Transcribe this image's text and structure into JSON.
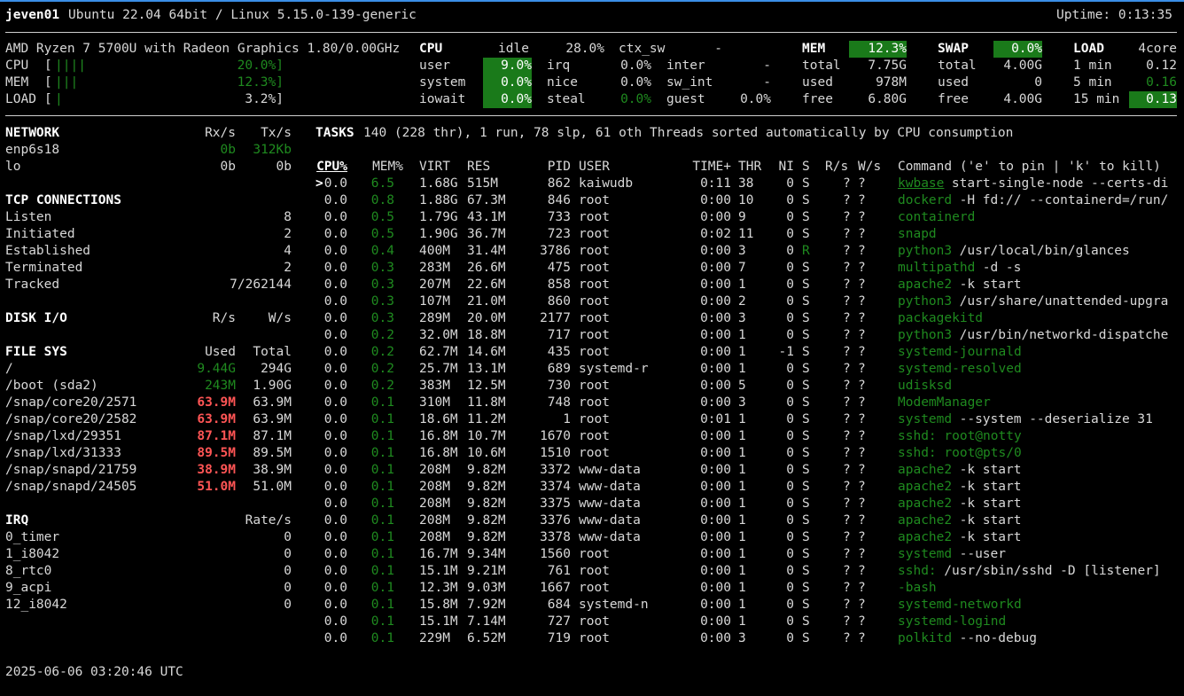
{
  "header": {
    "hostname": "jeven01",
    "os": "Ubuntu 22.04 64bit / Linux 5.15.0-139-generic",
    "uptime": "Uptime: 0:13:35"
  },
  "quicklook": {
    "cpu_name": "AMD Ryzen 7 5700U with Radeon Graphics 1.80/0.00GHz",
    "rows": [
      {
        "label": "CPU",
        "bar": "||||",
        "value": "20.0%]",
        "bar_fraction": 0.2
      },
      {
        "label": "MEM",
        "bar": "|||",
        "value": "12.3%]",
        "bar_fraction": 0.123
      },
      {
        "label": "LOAD",
        "bar": "|",
        "value": "3.2%]",
        "bar_fraction": 0.032
      }
    ]
  },
  "cpu": {
    "title": "CPU",
    "idle_label": "idle",
    "idle_value": "28.0%",
    "ctx_sw_label": "ctx_sw",
    "ctx_sw_value": "-",
    "rows": [
      {
        "l1": "user",
        "v1": "9.0%",
        "l2": "irq",
        "v2": "0.0%",
        "l3": "inter",
        "v3": "-"
      },
      {
        "l1": "system",
        "v1": "0.0%",
        "l2": "nice",
        "v2": "0.0%",
        "l3": "sw_int",
        "v3": "-"
      },
      {
        "l1": "iowait",
        "v1": "0.0%",
        "l2": "steal",
        "v2": "0.0%",
        "l3": "guest",
        "v3": "0.0%"
      }
    ]
  },
  "mem": {
    "title": "MEM",
    "percent": "12.3%",
    "rows": [
      {
        "label": "total",
        "value": "7.75G"
      },
      {
        "label": "used",
        "value": "978M"
      },
      {
        "label": "free",
        "value": "6.80G"
      }
    ]
  },
  "swap": {
    "title": "SWAP",
    "percent": "0.0%",
    "rows": [
      {
        "label": "total",
        "value": "4.00G"
      },
      {
        "label": "used",
        "value": "0"
      },
      {
        "label": "free",
        "value": "4.00G"
      }
    ]
  },
  "load": {
    "title": "LOAD",
    "cores": "4core",
    "rows": [
      {
        "label": "1 min",
        "value": "0.12"
      },
      {
        "label": "5 min",
        "value": "0.16"
      },
      {
        "label": "15 min",
        "value": "0.13"
      }
    ]
  },
  "network": {
    "title": "NETWORK",
    "rx": "Rx/s",
    "tx": "Tx/s",
    "rows": [
      {
        "name": "enp6s18",
        "rx": "0b",
        "tx": "312Kb"
      },
      {
        "name": "lo",
        "rx": "0b",
        "tx": "0b"
      }
    ]
  },
  "tcp": {
    "title": "TCP CONNECTIONS",
    "rows": [
      {
        "label": "Listen",
        "value": "8"
      },
      {
        "label": "Initiated",
        "value": "2"
      },
      {
        "label": "Established",
        "value": "4"
      },
      {
        "label": "Terminated",
        "value": "2"
      },
      {
        "label": "Tracked",
        "value": "7/262144"
      }
    ]
  },
  "diskio": {
    "title": "DISK I/O",
    "r": "R/s",
    "w": "W/s"
  },
  "filesys": {
    "title": "FILE SYS",
    "used": "Used",
    "total": "Total",
    "rows": [
      {
        "name": "/",
        "used": "9.44G",
        "total": "294G",
        "cls": "g"
      },
      {
        "name": "/boot (sda2)",
        "used": "243M",
        "total": "1.90G",
        "cls": "g"
      },
      {
        "name": "/snap/core20/2571",
        "used": "63.9M",
        "total": "63.9M",
        "cls": "red"
      },
      {
        "name": "/snap/core20/2582",
        "used": "63.9M",
        "total": "63.9M",
        "cls": "red"
      },
      {
        "name": "/snap/lxd/29351",
        "used": "87.1M",
        "total": "87.1M",
        "cls": "red"
      },
      {
        "name": "/snap/lxd/31333",
        "used": "89.5M",
        "total": "89.5M",
        "cls": "red"
      },
      {
        "name": "/snap/snapd/21759",
        "used": "38.9M",
        "total": "38.9M",
        "cls": "red"
      },
      {
        "name": "/snap/snapd/24505",
        "used": "51.0M",
        "total": "51.0M",
        "cls": "red"
      }
    ]
  },
  "irq": {
    "title": "IRQ",
    "rate": "Rate/s",
    "rows": [
      {
        "name": "0_timer",
        "value": "0"
      },
      {
        "name": "1_i8042",
        "value": "0"
      },
      {
        "name": "8_rtc0",
        "value": "0"
      },
      {
        "name": "9_acpi",
        "value": "0"
      },
      {
        "name": "12_i8042",
        "value": "0"
      }
    ]
  },
  "tasks": {
    "title": "TASKS",
    "summary": "140 (228 thr), 1 run, 78 slp, 61 oth Threads sorted automatically by CPU consumption"
  },
  "proc_headers": {
    "cpu": "CPU%",
    "mem": "MEM%",
    "virt": "VIRT",
    "res": "RES",
    "pid": "PID",
    "user": "USER",
    "time": "TIME+",
    "thr": "THR",
    "ni": "NI",
    "s": "S",
    "rs": "R/s",
    "ws": "W/s",
    "cmd": "Command ('e' to pin | 'k' to kill)"
  },
  "processes": [
    {
      "cur": ">",
      "cpu": "0.0",
      "mem": "6.5",
      "virt": "1.68G",
      "res": "515M",
      "pid": "862",
      "user": "kaiwudb",
      "time": "0:11",
      "thr": "38",
      "ni": "0",
      "s": "S",
      "rs": "?",
      "ws": "?",
      "cmd": "kwbase",
      "args": " start-single-node --certs-di",
      "cmd_ul": true
    },
    {
      "cur": "",
      "cpu": "0.0",
      "mem": "0.8",
      "virt": "1.88G",
      "res": "67.3M",
      "pid": "846",
      "user": "root",
      "time": "0:00",
      "thr": "10",
      "ni": "0",
      "s": "S",
      "rs": "?",
      "ws": "?",
      "cmd": "dockerd",
      "args": " -H fd:// --containerd=/run/"
    },
    {
      "cur": "",
      "cpu": "0.0",
      "mem": "0.5",
      "virt": "1.79G",
      "res": "43.1M",
      "pid": "733",
      "user": "root",
      "time": "0:00",
      "thr": "9",
      "ni": "0",
      "s": "S",
      "rs": "?",
      "ws": "?",
      "cmd": "containerd",
      "args": ""
    },
    {
      "cur": "",
      "cpu": "0.0",
      "mem": "0.5",
      "virt": "1.90G",
      "res": "36.7M",
      "pid": "723",
      "user": "root",
      "time": "0:02",
      "thr": "11",
      "ni": "0",
      "s": "S",
      "rs": "?",
      "ws": "?",
      "cmd": "snapd",
      "args": ""
    },
    {
      "cur": "",
      "cpu": "0.0",
      "mem": "0.4",
      "virt": "400M",
      "res": "31.4M",
      "pid": "3786",
      "user": "root",
      "time": "0:00",
      "thr": "3",
      "ni": "0",
      "s": "R",
      "rs": "?",
      "ws": "?",
      "cmd": "python3",
      "args": " /usr/local/bin/glances"
    },
    {
      "cur": "",
      "cpu": "0.0",
      "mem": "0.3",
      "virt": "283M",
      "res": "26.6M",
      "pid": "475",
      "user": "root",
      "time": "0:00",
      "thr": "7",
      "ni": "0",
      "s": "S",
      "rs": "?",
      "ws": "?",
      "cmd": "multipathd",
      "args": " -d -s"
    },
    {
      "cur": "",
      "cpu": "0.0",
      "mem": "0.3",
      "virt": "207M",
      "res": "22.6M",
      "pid": "858",
      "user": "root",
      "time": "0:00",
      "thr": "1",
      "ni": "0",
      "s": "S",
      "rs": "?",
      "ws": "?",
      "cmd": "apache2",
      "args": " -k start"
    },
    {
      "cur": "",
      "cpu": "0.0",
      "mem": "0.3",
      "virt": "107M",
      "res": "21.0M",
      "pid": "860",
      "user": "root",
      "time": "0:00",
      "thr": "2",
      "ni": "0",
      "s": "S",
      "rs": "?",
      "ws": "?",
      "cmd": "python3",
      "args": " /usr/share/unattended-upgra"
    },
    {
      "cur": "",
      "cpu": "0.0",
      "mem": "0.3",
      "virt": "289M",
      "res": "20.0M",
      "pid": "2177",
      "user": "root",
      "time": "0:00",
      "thr": "3",
      "ni": "0",
      "s": "S",
      "rs": "?",
      "ws": "?",
      "cmd": "packagekitd",
      "args": ""
    },
    {
      "cur": "",
      "cpu": "0.0",
      "mem": "0.2",
      "virt": "32.0M",
      "res": "18.8M",
      "pid": "717",
      "user": "root",
      "time": "0:00",
      "thr": "1",
      "ni": "0",
      "s": "S",
      "rs": "?",
      "ws": "?",
      "cmd": "python3",
      "args": " /usr/bin/networkd-dispatche"
    },
    {
      "cur": "",
      "cpu": "0.0",
      "mem": "0.2",
      "virt": "62.7M",
      "res": "14.6M",
      "pid": "435",
      "user": "root",
      "time": "0:00",
      "thr": "1",
      "ni": "-1",
      "s": "S",
      "rs": "?",
      "ws": "?",
      "cmd": "systemd-journald",
      "args": ""
    },
    {
      "cur": "",
      "cpu": "0.0",
      "mem": "0.2",
      "virt": "25.7M",
      "res": "13.1M",
      "pid": "689",
      "user": "systemd-r",
      "time": "0:00",
      "thr": "1",
      "ni": "0",
      "s": "S",
      "rs": "?",
      "ws": "?",
      "cmd": "systemd-resolved",
      "args": ""
    },
    {
      "cur": "",
      "cpu": "0.0",
      "mem": "0.2",
      "virt": "383M",
      "res": "12.5M",
      "pid": "730",
      "user": "root",
      "time": "0:00",
      "thr": "5",
      "ni": "0",
      "s": "S",
      "rs": "?",
      "ws": "?",
      "cmd": "udisksd",
      "args": ""
    },
    {
      "cur": "",
      "cpu": "0.0",
      "mem": "0.1",
      "virt": "310M",
      "res": "11.8M",
      "pid": "748",
      "user": "root",
      "time": "0:00",
      "thr": "3",
      "ni": "0",
      "s": "S",
      "rs": "?",
      "ws": "?",
      "cmd": "ModemManager",
      "args": ""
    },
    {
      "cur": "",
      "cpu": "0.0",
      "mem": "0.1",
      "virt": "18.6M",
      "res": "11.2M",
      "pid": "1",
      "user": "root",
      "time": "0:01",
      "thr": "1",
      "ni": "0",
      "s": "S",
      "rs": "?",
      "ws": "?",
      "cmd": "systemd",
      "args": " --system --deserialize 31"
    },
    {
      "cur": "",
      "cpu": "0.0",
      "mem": "0.1",
      "virt": "16.8M",
      "res": "10.7M",
      "pid": "1670",
      "user": "root",
      "time": "0:00",
      "thr": "1",
      "ni": "0",
      "s": "S",
      "rs": "?",
      "ws": "?",
      "cmd": "sshd: root@notty",
      "args": ""
    },
    {
      "cur": "",
      "cpu": "0.0",
      "mem": "0.1",
      "virt": "16.8M",
      "res": "10.6M",
      "pid": "1510",
      "user": "root",
      "time": "0:00",
      "thr": "1",
      "ni": "0",
      "s": "S",
      "rs": "?",
      "ws": "?",
      "cmd": "sshd: root@pts/0",
      "args": ""
    },
    {
      "cur": "",
      "cpu": "0.0",
      "mem": "0.1",
      "virt": "208M",
      "res": "9.82M",
      "pid": "3372",
      "user": "www-data",
      "time": "0:00",
      "thr": "1",
      "ni": "0",
      "s": "S",
      "rs": "?",
      "ws": "?",
      "cmd": "apache2",
      "args": " -k start"
    },
    {
      "cur": "",
      "cpu": "0.0",
      "mem": "0.1",
      "virt": "208M",
      "res": "9.82M",
      "pid": "3374",
      "user": "www-data",
      "time": "0:00",
      "thr": "1",
      "ni": "0",
      "s": "S",
      "rs": "?",
      "ws": "?",
      "cmd": "apache2",
      "args": " -k start"
    },
    {
      "cur": "",
      "cpu": "0.0",
      "mem": "0.1",
      "virt": "208M",
      "res": "9.82M",
      "pid": "3375",
      "user": "www-data",
      "time": "0:00",
      "thr": "1",
      "ni": "0",
      "s": "S",
      "rs": "?",
      "ws": "?",
      "cmd": "apache2",
      "args": " -k start"
    },
    {
      "cur": "",
      "cpu": "0.0",
      "mem": "0.1",
      "virt": "208M",
      "res": "9.82M",
      "pid": "3376",
      "user": "www-data",
      "time": "0:00",
      "thr": "1",
      "ni": "0",
      "s": "S",
      "rs": "?",
      "ws": "?",
      "cmd": "apache2",
      "args": " -k start"
    },
    {
      "cur": "",
      "cpu": "0.0",
      "mem": "0.1",
      "virt": "208M",
      "res": "9.82M",
      "pid": "3378",
      "user": "www-data",
      "time": "0:00",
      "thr": "1",
      "ni": "0",
      "s": "S",
      "rs": "?",
      "ws": "?",
      "cmd": "apache2",
      "args": " -k start"
    },
    {
      "cur": "",
      "cpu": "0.0",
      "mem": "0.1",
      "virt": "16.7M",
      "res": "9.34M",
      "pid": "1560",
      "user": "root",
      "time": "0:00",
      "thr": "1",
      "ni": "0",
      "s": "S",
      "rs": "?",
      "ws": "?",
      "cmd": "systemd",
      "args": " --user"
    },
    {
      "cur": "",
      "cpu": "0.0",
      "mem": "0.1",
      "virt": "15.1M",
      "res": "9.21M",
      "pid": "761",
      "user": "root",
      "time": "0:00",
      "thr": "1",
      "ni": "0",
      "s": "S",
      "rs": "?",
      "ws": "?",
      "cmd": "sshd:",
      "args": " /usr/sbin/sshd -D [listener]"
    },
    {
      "cur": "",
      "cpu": "0.0",
      "mem": "0.1",
      "virt": "12.3M",
      "res": "9.03M",
      "pid": "1667",
      "user": "root",
      "time": "0:00",
      "thr": "1",
      "ni": "0",
      "s": "S",
      "rs": "?",
      "ws": "?",
      "cmd": "-bash",
      "args": ""
    },
    {
      "cur": "",
      "cpu": "0.0",
      "mem": "0.1",
      "virt": "15.8M",
      "res": "7.92M",
      "pid": "684",
      "user": "systemd-n",
      "time": "0:00",
      "thr": "1",
      "ni": "0",
      "s": "S",
      "rs": "?",
      "ws": "?",
      "cmd": "systemd-networkd",
      "args": ""
    },
    {
      "cur": "",
      "cpu": "0.0",
      "mem": "0.1",
      "virt": "15.1M",
      "res": "7.14M",
      "pid": "727",
      "user": "root",
      "time": "0:00",
      "thr": "1",
      "ni": "0",
      "s": "S",
      "rs": "?",
      "ws": "?",
      "cmd": "systemd-logind",
      "args": ""
    },
    {
      "cur": "",
      "cpu": "0.0",
      "mem": "0.1",
      "virt": "229M",
      "res": "6.52M",
      "pid": "719",
      "user": "root",
      "time": "0:00",
      "thr": "3",
      "ni": "0",
      "s": "S",
      "rs": "?",
      "ws": "?",
      "cmd": "polkitd",
      "args": " --no-debug"
    }
  ],
  "footer": {
    "datetime": "2025-06-06 03:20:46 UTC"
  },
  "colors": {
    "accent_green": "#1a7a1a",
    "dim_green": "#1f8a1f",
    "alert_red": "#ff5555",
    "top_border": "#3a8ee6"
  }
}
